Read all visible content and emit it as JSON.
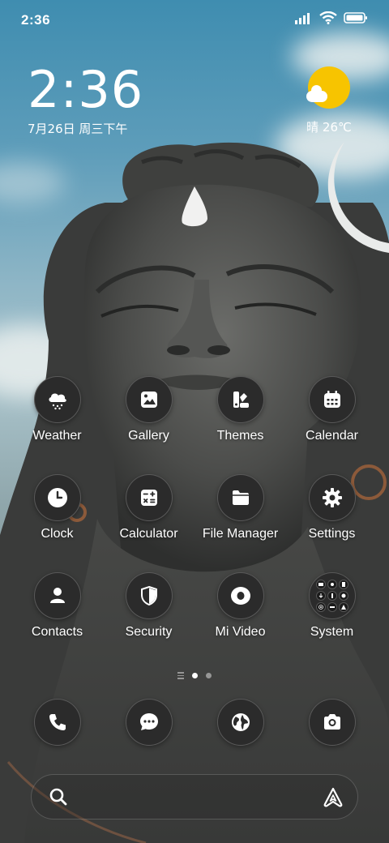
{
  "status_bar": {
    "time": "2:36",
    "icons": [
      "signal-icon",
      "wifi-icon",
      "battery-icon"
    ]
  },
  "clock_widget": {
    "time": "2:36",
    "date": "7月26日 周三下午"
  },
  "weather_widget": {
    "icon": "sunny-partly-cloudy-icon",
    "text": "晴 26℃"
  },
  "apps": [
    {
      "label": "Weather",
      "icon": "cloud-rain-icon"
    },
    {
      "label": "Gallery",
      "icon": "photo-icon"
    },
    {
      "label": "Themes",
      "icon": "palette-icon"
    },
    {
      "label": "Calendar",
      "icon": "calendar-icon"
    },
    {
      "label": "Clock",
      "icon": "clock-icon"
    },
    {
      "label": "Calculator",
      "icon": "calculator-icon"
    },
    {
      "label": "File Manager",
      "icon": "folder-icon"
    },
    {
      "label": "Settings",
      "icon": "gear-icon"
    },
    {
      "label": "Contacts",
      "icon": "person-icon"
    },
    {
      "label": "Security",
      "icon": "shield-icon"
    },
    {
      "label": "Mi Video",
      "icon": "play-circle-icon"
    },
    {
      "label": "System",
      "icon": "folder-grid-icon"
    }
  ],
  "page_indicator": {
    "pages": 2,
    "current": 1
  },
  "dock": [
    {
      "icon": "phone-icon"
    },
    {
      "icon": "message-icon"
    },
    {
      "icon": "globe-icon"
    },
    {
      "icon": "camera-icon"
    }
  ],
  "search_bar": {
    "left_icon": "search-icon",
    "right_icon": "assistant-icon"
  },
  "colors": {
    "icon_bg": "#2b2b2b",
    "sun": "#f7c400",
    "sky": "#5e9dba"
  }
}
